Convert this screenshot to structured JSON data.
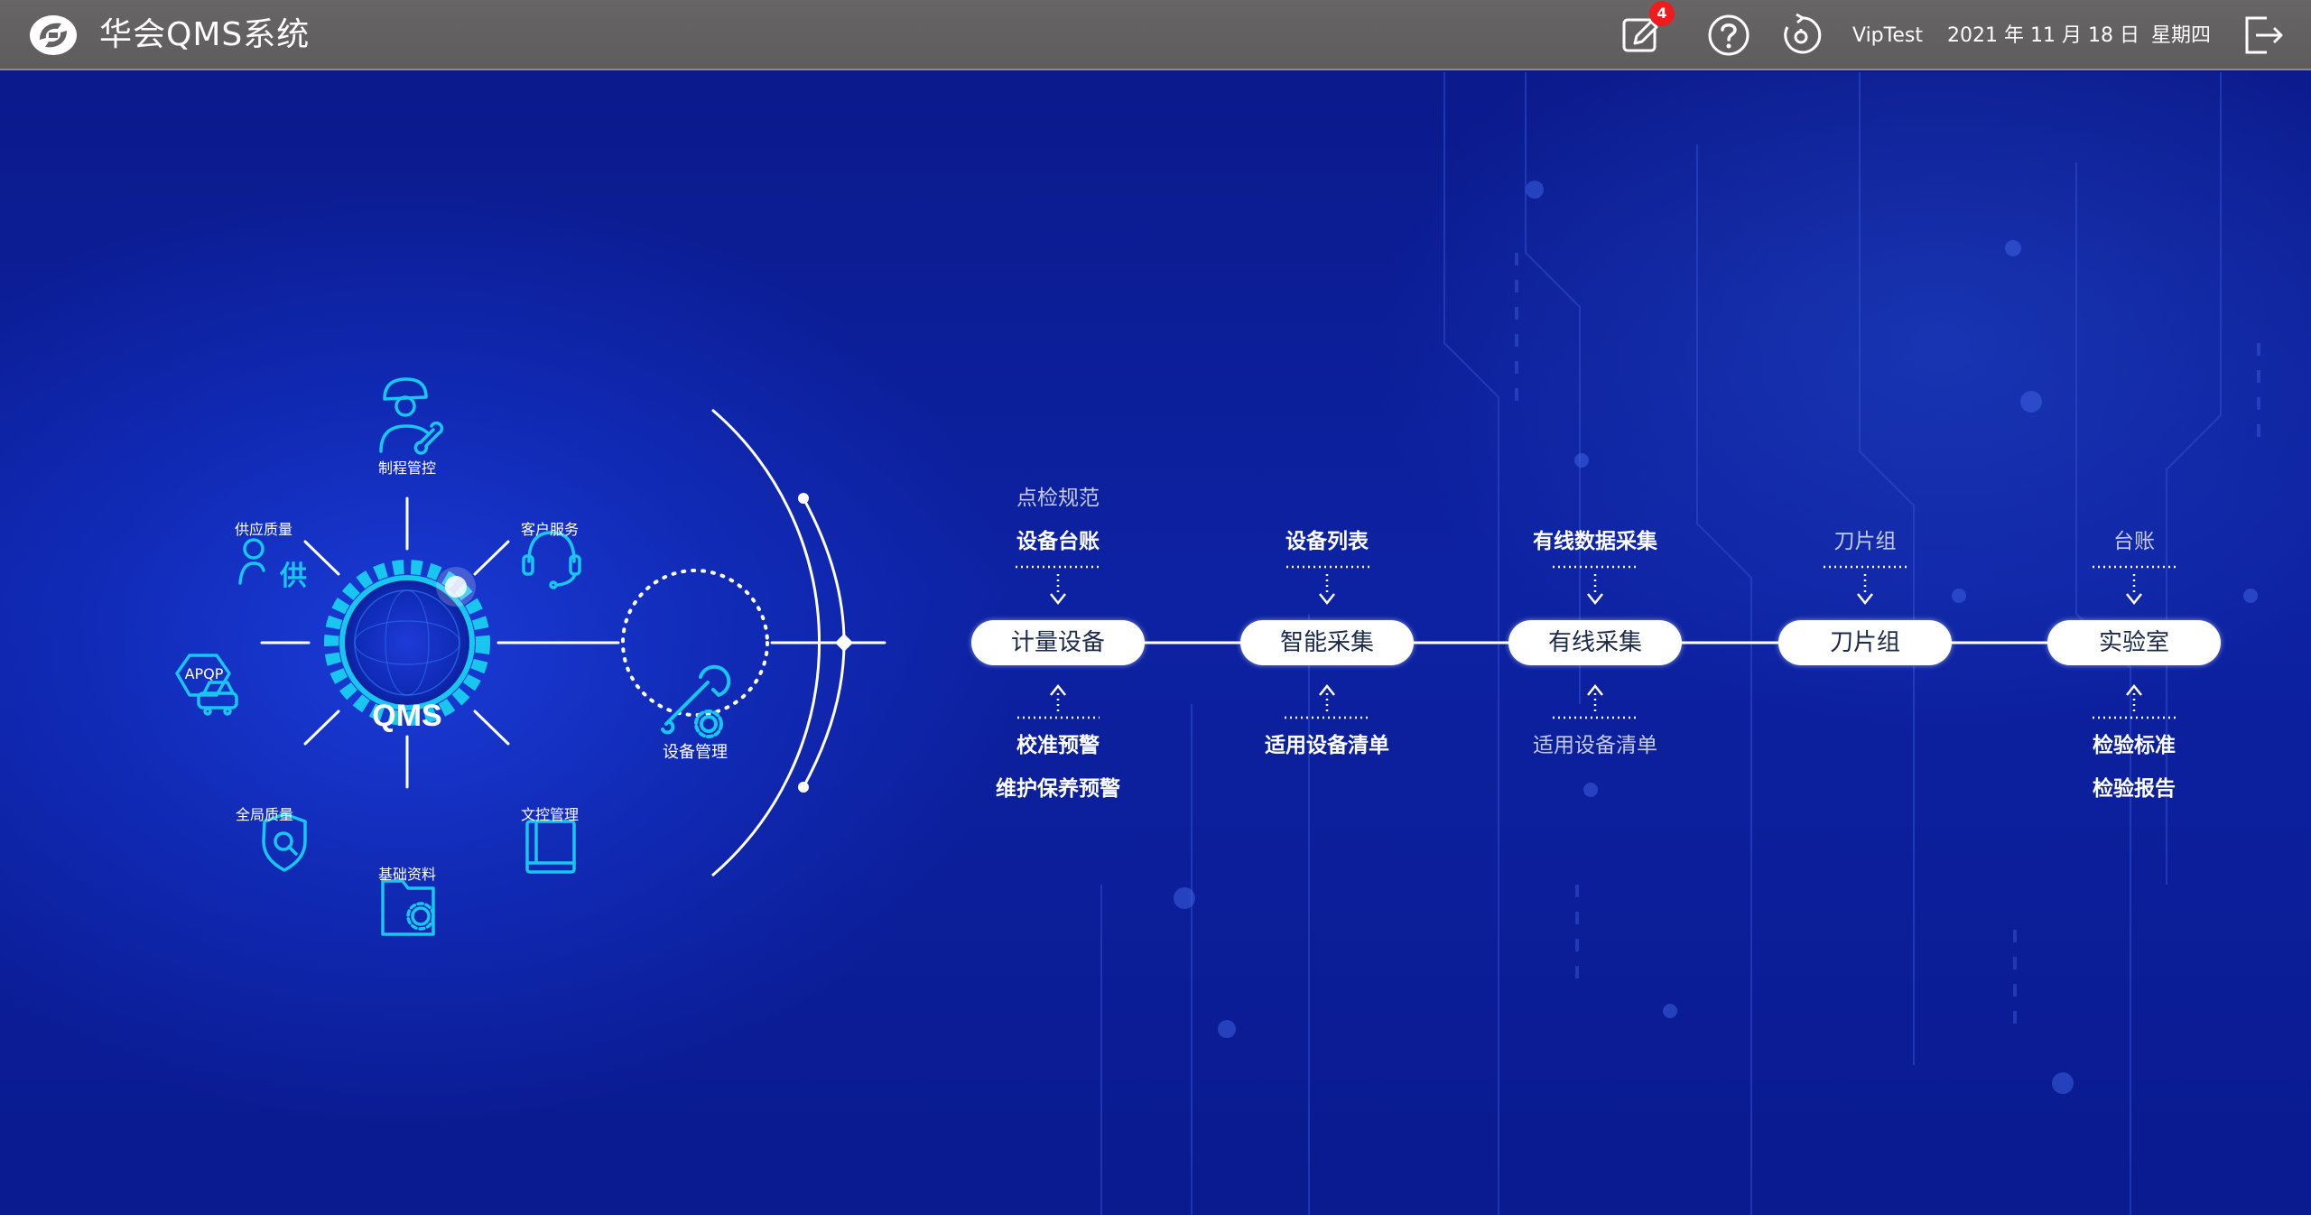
{
  "header": {
    "title": "华会QMS系统",
    "notification_count": "4",
    "user": "VipTest",
    "date": "2021 年 11 月 18 日",
    "weekday": "星期四"
  },
  "hub": {
    "center_label": "QMS",
    "modules": [
      {
        "label": "制程管控",
        "icon": "engineer-wrench-icon"
      },
      {
        "label": "客户服务",
        "icon": "headset-icon"
      },
      {
        "label": "文控管理",
        "icon": "book-icon"
      },
      {
        "label": "基础资料",
        "icon": "folder-gear-icon"
      },
      {
        "label": "全局质量",
        "icon": "shield-search-icon"
      },
      {
        "label": "APQP",
        "icon": "car-icon"
      },
      {
        "label": "供应质量",
        "icon": "supplier-icon"
      }
    ],
    "active_module": {
      "label": "设备管理",
      "icon": "wrench-gear-icon"
    }
  },
  "flow": [
    {
      "name": "计量设备",
      "top": [
        "点检规范",
        "设备台账"
      ],
      "bottom": [
        "校准预警",
        "维护保养预警"
      ]
    },
    {
      "name": "智能采集",
      "top": [
        "设备列表"
      ],
      "bottom": [
        "适用设备清单"
      ]
    },
    {
      "name": "有线采集",
      "top": [
        "有线数据采集"
      ],
      "bottom": [
        "适用设备清单"
      ]
    },
    {
      "name": "刀片组",
      "top": [
        "刀片组"
      ],
      "bottom": []
    },
    {
      "name": "实验室",
      "top": [
        "台账"
      ],
      "bottom": [
        "检验标准",
        "检验报告"
      ]
    }
  ],
  "colors": {
    "header_bg": "#646262",
    "main_bg": "#0a1a8f",
    "accent_cyan": "#19c6f0",
    "badge_red": "#ee1c1c"
  }
}
